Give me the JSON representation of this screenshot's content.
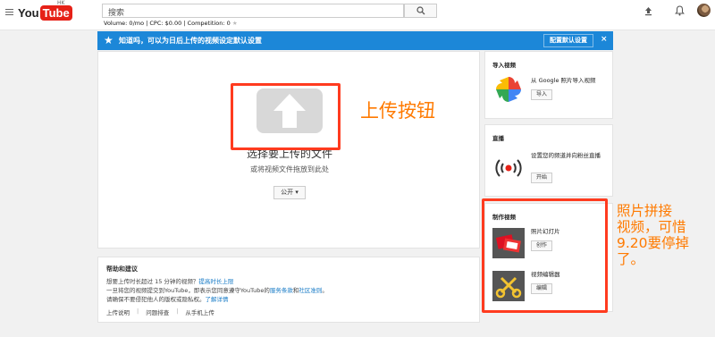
{
  "header": {
    "logo_you": "You",
    "logo_tube": "Tube",
    "region": "HK",
    "search_placeholder": "搜索",
    "volume_text": "Volume: 0/mo | CPC: $0.00 | Competition: 0",
    "star_glyph": "★"
  },
  "banner": {
    "icon": "star-icon",
    "text": "知道吗，可以为日后上传的视频设定默认设置",
    "button_label": "配置默认设置",
    "close_glyph": "×"
  },
  "upload": {
    "title": "选择要上传的文件",
    "subtitle": "或将视频文件拖放到此处",
    "privacy_label": "公开",
    "privacy_caret": "▾",
    "annotation": "上传按钮"
  },
  "help": {
    "title": "帮助和建议",
    "line1_text": "想要上传时长超过 15 分钟的视频？",
    "line1_link": "提高时长上限",
    "line2_prefix": "一旦将您的视频提交到YouTube，即表示您同意遵守YouTube的",
    "line2_link1": "服务条款",
    "line2_and": "和",
    "line2_link2": "社区准则",
    "line2_suffix": "。",
    "line3_text": "请确保不要侵犯他人的版权或隐私权。",
    "line3_link": "了解详情",
    "links": [
      "上传说明",
      "问题排查",
      "从手机上传"
    ]
  },
  "import_card": {
    "title": "导入视频",
    "text": "从 Google 照片导入视频",
    "button": "导入"
  },
  "live_card": {
    "title": "直播",
    "text": "设置您的频道并向粉丝直播",
    "button": "开始"
  },
  "create_card": {
    "title": "制作视频",
    "slideshow_text": "照片幻灯片",
    "slideshow_button": "创作",
    "editor_text": "视频编辑器",
    "editor_button": "编辑"
  },
  "side_annotation": [
    "照片拼接",
    "视频，可惜",
    "9.20要停掉",
    "了。"
  ],
  "colors": {
    "brand_red": "#e62117",
    "banner_blue": "#1c87d8",
    "annotation_red": "#ff3b1f",
    "annotation_orange": "#ff7a00",
    "link_blue": "#167ac6"
  }
}
